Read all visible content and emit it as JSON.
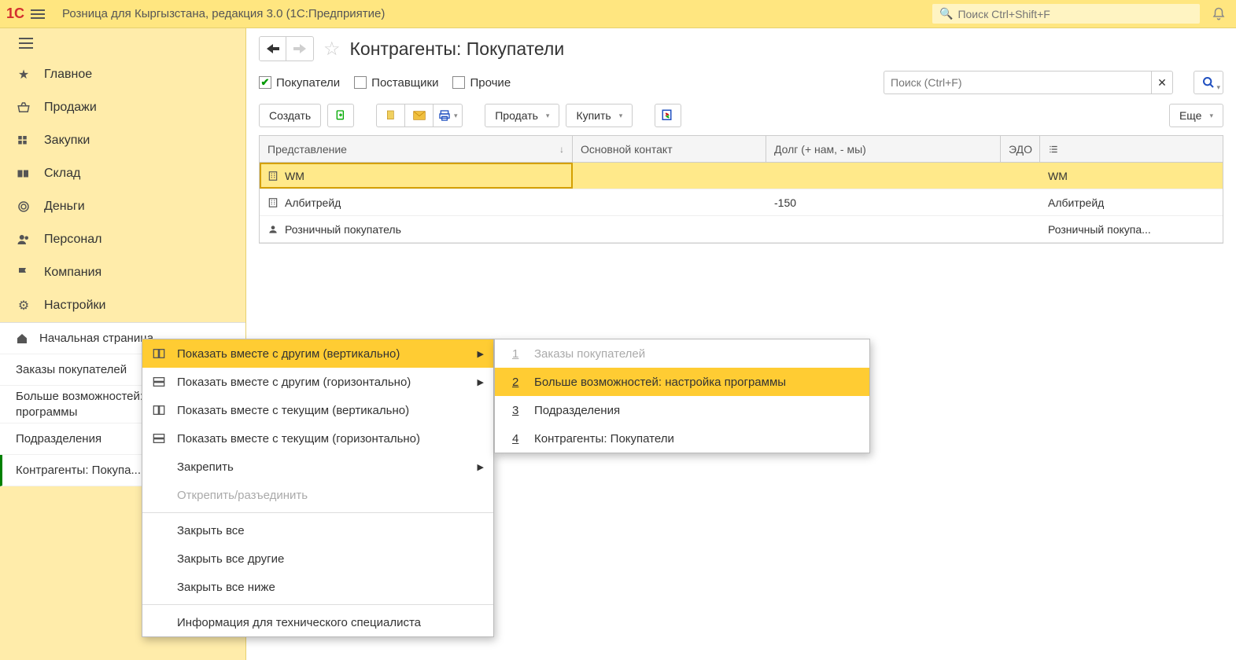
{
  "header": {
    "app_title": "Розница для Кыргызстана, редакция 3.0  (1С:Предприятие)",
    "search_placeholder": "Поиск Ctrl+Shift+F"
  },
  "sidebar": {
    "items": [
      {
        "label": "Главное"
      },
      {
        "label": "Продажи"
      },
      {
        "label": "Закупки"
      },
      {
        "label": "Склад"
      },
      {
        "label": "Деньги"
      },
      {
        "label": "Персонал"
      },
      {
        "label": "Компания"
      },
      {
        "label": "Настройки"
      }
    ],
    "subitems": [
      {
        "label": "Начальная страница"
      },
      {
        "label": "Заказы покупателей"
      },
      {
        "label": "Больше возможностей: настройка программы"
      },
      {
        "label": "Подразделения"
      },
      {
        "label": "Контрагенты: Покупа..."
      }
    ]
  },
  "page": {
    "title": "Контрагенты: Покупатели",
    "filters": {
      "buyers": "Покупатели",
      "suppliers": "Поставщики",
      "others": "Прочие"
    },
    "search_placeholder": "Поиск (Ctrl+F)",
    "toolbar": {
      "create": "Создать",
      "sell": "Продать",
      "buy": "Купить",
      "more": "Еще"
    },
    "columns": {
      "name": "Представление",
      "contact": "Основной контакт",
      "debt": "Долг (+ нам, - мы)",
      "edo": "ЭДО"
    },
    "rows": [
      {
        "icon": "building",
        "name": "WM",
        "contact": "",
        "debt": "",
        "right": "WM"
      },
      {
        "icon": "building",
        "name": "Албитрейд",
        "contact": "",
        "debt": "-150",
        "right": "Албитрейд"
      },
      {
        "icon": "person",
        "name": "Розничный покупатель",
        "contact": "",
        "debt": "",
        "right": "Розничный покупа..."
      }
    ]
  },
  "context_menu": {
    "items": [
      {
        "label": "Показать вместе с другим (вертикально)",
        "icon": "split-v",
        "arrow": true,
        "sel": true
      },
      {
        "label": "Показать вместе с другим (горизонтально)",
        "icon": "split-h",
        "arrow": true
      },
      {
        "label": "Показать вместе с текущим (вертикально)",
        "icon": "split-v"
      },
      {
        "label": "Показать вместе с текущим (горизонтально)",
        "icon": "split-h"
      },
      {
        "label": "Закрепить",
        "arrow": true
      },
      {
        "label": "Открепить/разъединить",
        "disabled": true
      },
      {
        "sep": true
      },
      {
        "label": "Закрыть все"
      },
      {
        "label": "Закрыть все другие"
      },
      {
        "label": "Закрыть все ниже"
      },
      {
        "sep": true
      },
      {
        "label": "Информация для технического специалиста"
      }
    ]
  },
  "submenu": {
    "items": [
      {
        "num": "1",
        "label": "Заказы покупателей",
        "disabled": true
      },
      {
        "num": "2",
        "label": "Больше возможностей: настройка программы",
        "sel": true
      },
      {
        "num": "3",
        "label": "Подразделения"
      },
      {
        "num": "4",
        "label": "Контрагенты: Покупатели"
      }
    ]
  }
}
